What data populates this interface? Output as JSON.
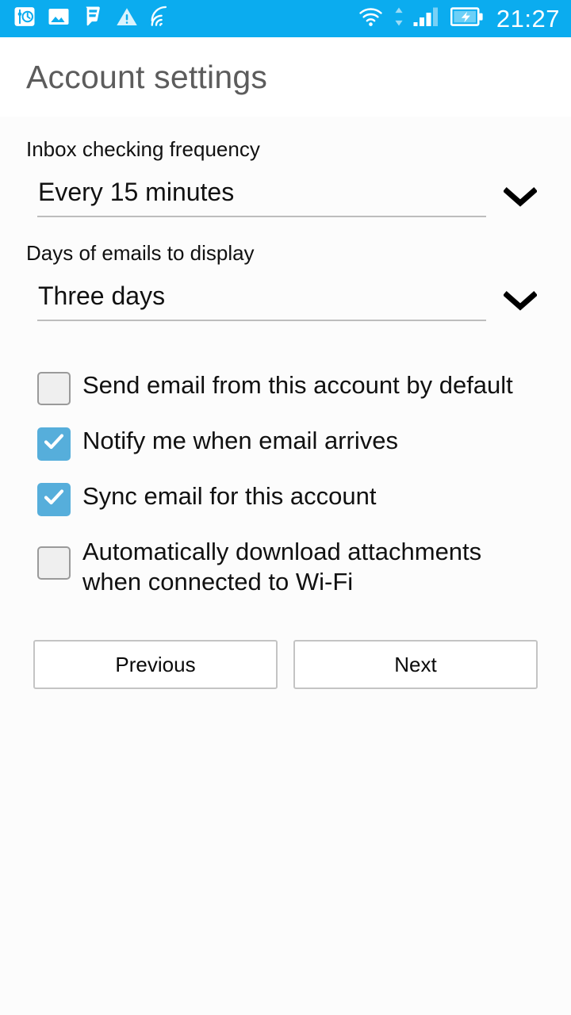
{
  "status_bar": {
    "background_color": "#0BACEF",
    "time": "21:27",
    "left_icons": [
      {
        "name": "alarm-clock-icon"
      },
      {
        "name": "photo-image-icon"
      },
      {
        "name": "foursquare-icon"
      },
      {
        "name": "warning-triangle-icon"
      },
      {
        "name": "nfc-broadcast-icon"
      }
    ],
    "right_icons": [
      {
        "name": "wifi-icon"
      },
      {
        "name": "data-transfer-arrows-icon"
      },
      {
        "name": "cellular-signal-icon"
      },
      {
        "name": "battery-charging-icon"
      }
    ]
  },
  "header": {
    "title": "Account settings"
  },
  "form": {
    "fields": [
      {
        "label": "Inbox checking frequency",
        "value": "Every 15 minutes"
      },
      {
        "label": "Days of emails to display",
        "value": "Three days"
      }
    ],
    "checkboxes": [
      {
        "label": "Send email from this account by default",
        "checked": false
      },
      {
        "label": "Notify me when email arrives",
        "checked": true
      },
      {
        "label": "Sync email for this account",
        "checked": true
      },
      {
        "label": "Automatically download attachments when connected to Wi-Fi",
        "checked": false
      }
    ]
  },
  "buttons": {
    "previous_label": "Previous",
    "next_label": "Next"
  },
  "colors": {
    "accent_blue": "#0BACEF",
    "checkbox_blue": "#56AEDB",
    "page_background": "#FCFCFC",
    "title_text": "#5C5C5C",
    "divider_gray": "#BDBDBD"
  }
}
